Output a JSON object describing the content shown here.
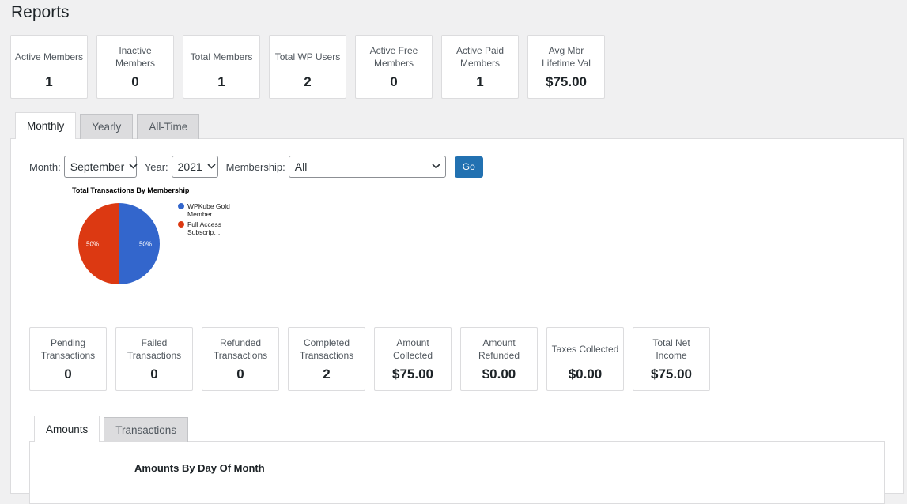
{
  "page": {
    "title": "Reports"
  },
  "top_stats": [
    {
      "label": "Active Members",
      "value": "1"
    },
    {
      "label": "Inactive Members",
      "value": "0"
    },
    {
      "label": "Total Members",
      "value": "1"
    },
    {
      "label": "Total WP Users",
      "value": "2"
    },
    {
      "label": "Active Free Members",
      "value": "0"
    },
    {
      "label": "Active Paid Members",
      "value": "1"
    },
    {
      "label": "Avg Mbr Lifetime Val",
      "value": "$75.00"
    }
  ],
  "main_tabs": [
    {
      "label": "Monthly",
      "active": true
    },
    {
      "label": "Yearly",
      "active": false
    },
    {
      "label": "All-Time",
      "active": false
    }
  ],
  "filters": {
    "month_label": "Month:",
    "month_value": "September",
    "year_label": "Year:",
    "year_value": "2021",
    "membership_label": "Membership:",
    "membership_value": "All",
    "go_label": "Go"
  },
  "chart_data": {
    "type": "pie",
    "title": "Total Transactions By Membership",
    "slices": [
      {
        "label": "WPKube Gold Member…",
        "value": 50,
        "display": "50%",
        "color": "#3366cc"
      },
      {
        "label": "Full Access Subscrip…",
        "value": 50,
        "display": "50%",
        "color": "#dc3912"
      }
    ],
    "legend_position": "right"
  },
  "mid_stats": [
    {
      "label": "Pending Transactions",
      "value": "0"
    },
    {
      "label": "Failed Transactions",
      "value": "0"
    },
    {
      "label": "Refunded Transactions",
      "value": "0"
    },
    {
      "label": "Completed Transactions",
      "value": "2"
    },
    {
      "label": "Amount Collected",
      "value": "$75.00"
    },
    {
      "label": "Amount Refunded",
      "value": "$0.00"
    },
    {
      "label": "Taxes Collected",
      "value": "$0.00"
    },
    {
      "label": "Total Net Income",
      "value": "$75.00"
    }
  ],
  "sub_tabs": [
    {
      "label": "Amounts",
      "active": true
    },
    {
      "label": "Transactions",
      "active": false
    }
  ],
  "amounts": {
    "title": "Amounts By Day Of Month"
  },
  "icons": {
    "dropdown": "chevron-down-icon"
  }
}
